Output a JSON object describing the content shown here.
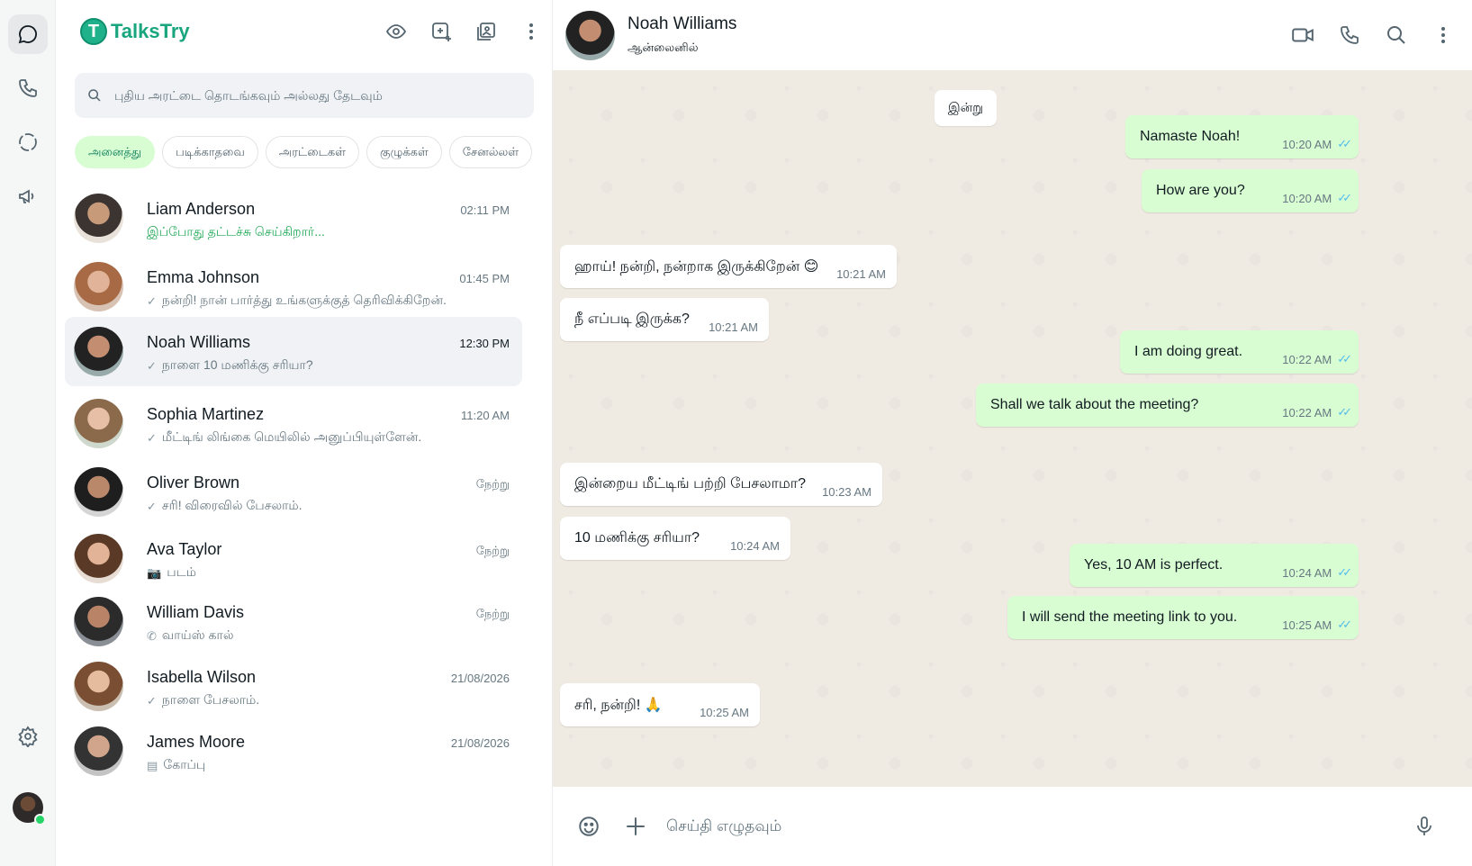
{
  "app": {
    "name": "TalksTry"
  },
  "colors": {
    "accent": "#19a57e",
    "outgoing_bubble": "#d9fdd3",
    "incoming_bubble": "#ffffff",
    "read_tick": "#53bdeb",
    "online": "#25d366"
  },
  "rail": {
    "items": [
      "chats-icon",
      "calls-icon",
      "status-icon",
      "channels-icon"
    ],
    "bottom": [
      "settings-icon",
      "profile-avatar"
    ]
  },
  "sidebar": {
    "search_placeholder": "புதிய அரட்டை தொடங்கவும் அல்லது தேடவும்",
    "filters": [
      "அனைத்து",
      "படிக்காதவை",
      "அரட்டைகள்",
      "குழுக்கள்",
      "சேனல்லள்"
    ],
    "chats": [
      {
        "name": "Liam Anderson",
        "time": "02:11 PM",
        "preview": "இப்போது தட்டச்சு செய்கிறார்...",
        "icon": ""
      },
      {
        "name": "Emma Johnson",
        "time": "01:45 PM",
        "preview": "நன்றி! நான் பார்த்து உங்களுக்குத் தெரிவிக்கிறேன்.",
        "icon": "✓"
      },
      {
        "name": "Noah Williams",
        "time": "12:30 PM",
        "preview": "நாளை 10 மணிக்கு சரியா?",
        "icon": "✓"
      },
      {
        "name": "Sophia Martinez",
        "time": "11:20 AM",
        "preview": "மீட்டிங் லிங்கை மெயிலில் அனுப்பியுள்ளேன்.",
        "icon": "✓"
      },
      {
        "name": "Oliver Brown",
        "time": "நேற்று",
        "preview": "சரி! விரைவில் பேசலாம்.",
        "icon": "✓"
      },
      {
        "name": "Ava Taylor",
        "time": "நேற்று",
        "preview": "படம்",
        "icon": "📷"
      },
      {
        "name": "William Davis",
        "time": "நேற்று",
        "preview": "வாய்ஸ் கால்",
        "icon": "✆"
      },
      {
        "name": "Isabella Wilson",
        "time": "21/08/2026",
        "preview": "நாளை பேசலாம்.",
        "icon": "✓"
      },
      {
        "name": "James Moore",
        "time": "21/08/2026",
        "preview": "கோப்பு",
        "icon": "▤"
      }
    ]
  },
  "chat": {
    "contact_name": "Noah Williams",
    "status": "ஆன்லைனில்",
    "day_label": "இன்று",
    "messages": [
      {
        "dir": "out",
        "text": "Namaste Noah!",
        "time": "10:20 AM"
      },
      {
        "dir": "out",
        "text": "How are you?",
        "time": "10:20 AM"
      },
      {
        "dir": "in",
        "text": "ஹாய்! நன்றி, நன்றாக இருக்கிறேன் 😊",
        "time": "10:21 AM"
      },
      {
        "dir": "in",
        "text": "நீ எப்படி இருக்க?",
        "time": "10:21 AM"
      },
      {
        "dir": "out",
        "text": "I am doing great.",
        "time": "10:22 AM"
      },
      {
        "dir": "out",
        "text": "Shall we talk about the meeting?",
        "time": "10:22 AM"
      },
      {
        "dir": "in",
        "text": "இன்றைய மீட்டிங் பற்றி பேசலாமா?",
        "time": "10:23 AM"
      },
      {
        "dir": "in",
        "text": "10 மணிக்கு சரியா?",
        "time": "10:24 AM"
      },
      {
        "dir": "out",
        "text": "Yes, 10 AM is perfect.",
        "time": "10:24 AM"
      },
      {
        "dir": "out",
        "text": "I will send the meeting link to you.",
        "time": "10:25 AM"
      },
      {
        "dir": "in",
        "text": "சரி, நன்றி! 🙏",
        "time": "10:25 AM"
      }
    ],
    "composer_placeholder": "செய்தி எழுதவும்"
  }
}
